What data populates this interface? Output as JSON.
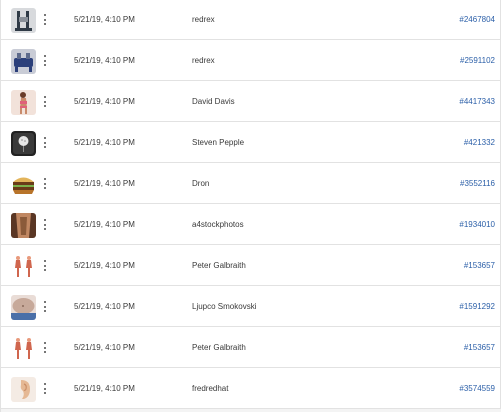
{
  "rows": [
    {
      "thumb": "gym-machine-thumbnail",
      "colors": [
        "#2f3a46",
        "#8a9099",
        "#d8dadd"
      ],
      "date": "5/21/19, 4:10 PM",
      "author": "redrex",
      "id": "#2467804"
    },
    {
      "thumb": "gym-machine-thumbnail",
      "colors": [
        "#2b3f7a",
        "#5e6b8c",
        "#c9ccd6"
      ],
      "date": "5/21/19, 4:10 PM",
      "author": "redrex",
      "id": "#2591102"
    },
    {
      "thumb": "woman-in-bikini-thumbnail",
      "colors": [
        "#c98b6b",
        "#e0607a",
        "#f2e2da"
      ],
      "date": "5/21/19, 4:10 PM",
      "author": "David Davis",
      "id": "#4417343"
    },
    {
      "thumb": "golf-ball-app-icon-thumbnail",
      "colors": [
        "#222222",
        "#8c8c8c",
        "#e6e6e6"
      ],
      "date": "5/21/19, 4:10 PM",
      "author": "Steven Pepple",
      "id": "#421332"
    },
    {
      "thumb": "burger-thumbnail",
      "colors": [
        "#b8742a",
        "#e3b45a",
        "#6a3b18"
      ],
      "date": "5/21/19, 4:10 PM",
      "author": "Dron",
      "id": "#3552116"
    },
    {
      "thumb": "torso-thumbnail",
      "colors": [
        "#8a5a3a",
        "#c08762",
        "#5a3624"
      ],
      "date": "5/21/19, 4:10 PM",
      "author": "a4stockphotos",
      "id": "#1934010"
    },
    {
      "thumb": "anatomy-figures-thumbnail",
      "colors": [
        "#d0664e",
        "#e89a7c",
        "#ffffff"
      ],
      "date": "5/21/19, 4:10 PM",
      "author": "Peter Galbraith",
      "id": "#153657"
    },
    {
      "thumb": "belly-thumbnail",
      "colors": [
        "#c7a99a",
        "#4a6fa8",
        "#e9dcd6"
      ],
      "date": "5/21/19, 4:10 PM",
      "author": "Ljupco Smokovski",
      "id": "#1591292"
    },
    {
      "thumb": "anatomy-figures-thumbnail",
      "colors": [
        "#d0664e",
        "#e89a7c",
        "#ffffff"
      ],
      "date": "5/21/19, 4:10 PM",
      "author": "Peter Galbraith",
      "id": "#153657"
    },
    {
      "thumb": "ear-thumbnail",
      "colors": [
        "#e5b894",
        "#c98e68",
        "#f4ebe4"
      ],
      "date": "5/21/19, 4:10 PM",
      "author": "fredredhat",
      "id": "#3574559"
    }
  ],
  "row_menu_icon": "more-vertical-icon",
  "colors": {
    "link": "#2b5fa8",
    "divider": "#e2e2e2",
    "text": "#3a3a3a"
  }
}
